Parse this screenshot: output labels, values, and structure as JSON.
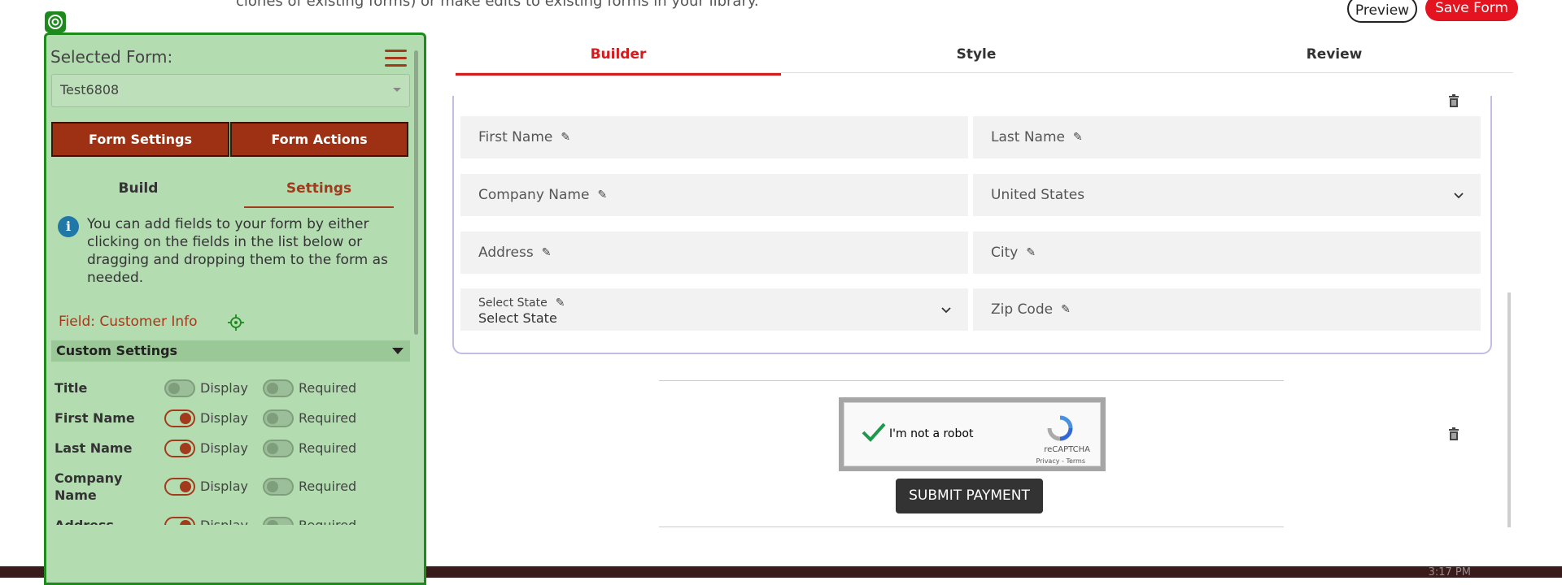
{
  "header": {
    "intro_text": "clones of existing forms) or make edits to existing forms in your library.",
    "preview_label": "Preview",
    "save_label": "Save Form"
  },
  "tabs": [
    {
      "label": "Builder",
      "active": true
    },
    {
      "label": "Style",
      "active": false
    },
    {
      "label": "Review",
      "active": false
    }
  ],
  "form": {
    "fields": {
      "first_name": "First Name",
      "last_name": "Last Name",
      "company_name": "Company Name",
      "country": "United States",
      "address": "Address",
      "city": "City",
      "state_label": "Select State",
      "state_value": "Select State",
      "zip_code": "Zip Code"
    },
    "captcha": {
      "label": "I'm not a robot",
      "brand": "reCAPTCHA",
      "links": "Privacy - Terms",
      "checked": true
    },
    "submit_label": "SUBMIT PAYMENT"
  },
  "panel": {
    "selected_form_label": "Selected Form:",
    "selected_form_value": "Test6808",
    "form_settings_label": "Form Settings",
    "form_actions_label": "Form Actions",
    "sub_tabs": [
      {
        "label": "Build",
        "active": false
      },
      {
        "label": "Settings",
        "active": true
      }
    ],
    "info_icon_glyph": "i",
    "info_text": "You can add fields to your form by either clicking on the fields in the list below or dragging and dropping them to the form as needed.",
    "field_label": "Field: Customer Info",
    "custom_settings_label": "Custom Settings",
    "rows": [
      {
        "label": "Title",
        "display": false,
        "required": false
      },
      {
        "label": "First Name",
        "display": true,
        "required": false
      },
      {
        "label": "Last Name",
        "display": true,
        "required": false
      },
      {
        "label": "Company Name",
        "display": true,
        "required": false
      },
      {
        "label": "Address",
        "display": true,
        "required": false
      }
    ],
    "display_label": "Display",
    "required_label": "Required"
  },
  "taskbar": {
    "time": "3:17 PM"
  },
  "colors": {
    "accent_red": "#e3131f",
    "panel_green": "#b3dcb1",
    "panel_border": "#1e8a1e",
    "brown": "#9e3113"
  }
}
